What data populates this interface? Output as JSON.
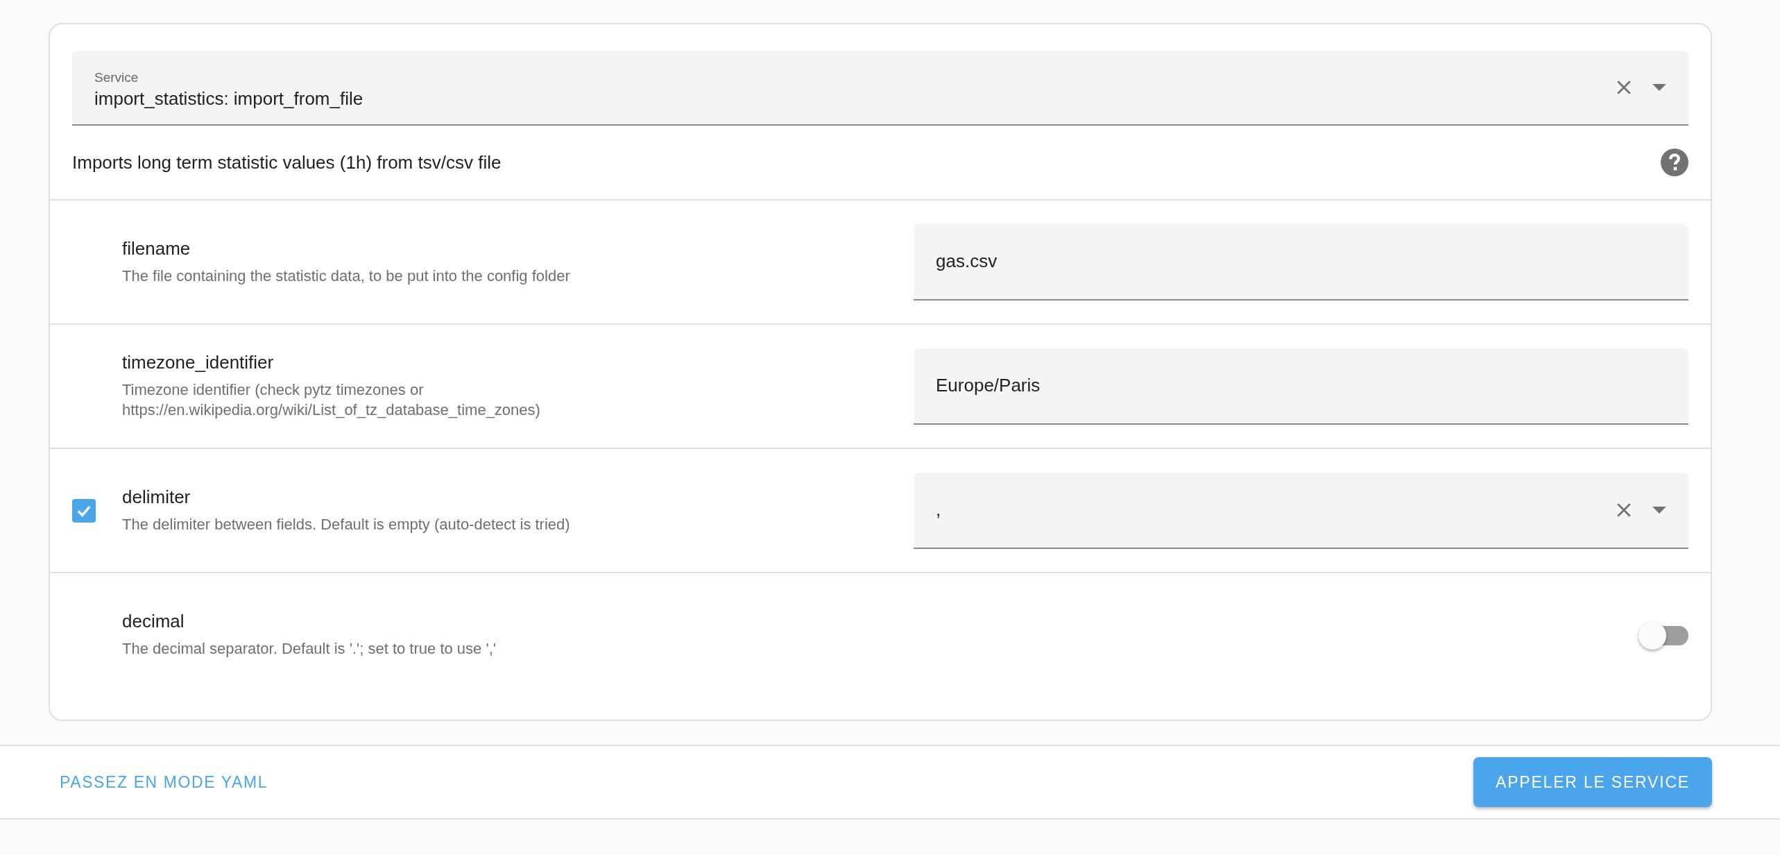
{
  "service": {
    "label": "Service",
    "value": "import_statistics: import_from_file"
  },
  "description": "Imports long term statistic values (1h) from tsv/csv file",
  "fields": [
    {
      "kind": "text",
      "name": "filename",
      "description": "The file containing the statistic data, to be put into the config folder",
      "value": "gas.csv"
    },
    {
      "kind": "text",
      "name": "timezone_identifier",
      "description": "Timezone identifier (check pytz timezones or https://en.wikipedia.org/wiki/List_of_tz_database_time_zones)",
      "value": "Europe/Paris"
    },
    {
      "kind": "select",
      "name": "delimiter",
      "description": "The delimiter between fields. Default is empty (auto-detect is tried)",
      "value": ",",
      "checkbox": {
        "checked": true
      }
    },
    {
      "kind": "toggle",
      "name": "decimal",
      "description": "The decimal separator. Default is '.'; set to true to use ','",
      "on": false
    }
  ],
  "footer": {
    "yaml_link": "PASSEZ EN MODE YAML",
    "call_button": "APPELER LE SERVICE"
  }
}
